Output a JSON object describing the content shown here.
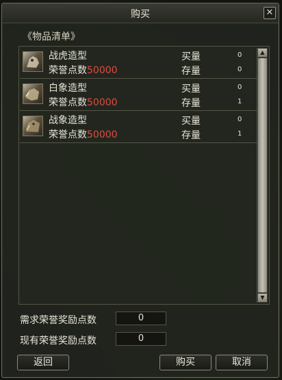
{
  "window": {
    "title": "购买",
    "close_glyph": "✕"
  },
  "list": {
    "section_label": "《物品清单》",
    "rows": [
      {
        "name": "战虎造型",
        "price_label": "荣誉点数",
        "price": "50000",
        "buy_label": "买量",
        "buy_value": "0",
        "stock_label": "存量",
        "stock_value": "0",
        "icon": "war-tiger-icon"
      },
      {
        "name": "白象造型",
        "price_label": "荣誉点数",
        "price": "50000",
        "buy_label": "买量",
        "buy_value": "0",
        "stock_label": "存量",
        "stock_value": "1",
        "icon": "white-elephant-icon"
      },
      {
        "name": "战象造型",
        "price_label": "荣誉点数",
        "price": "50000",
        "buy_label": "买量",
        "buy_value": "0",
        "stock_label": "存量",
        "stock_value": "1",
        "icon": "war-elephant-icon"
      }
    ],
    "scroll_up_glyph": "▲",
    "scroll_down_glyph": "▼"
  },
  "summary": {
    "required_label": "需求荣誉奖励点数",
    "required_value": "0",
    "current_label": "现有荣誉奖励点数",
    "current_value": "0"
  },
  "buttons": {
    "back": "返回",
    "buy": "购买",
    "cancel": "取消"
  }
}
